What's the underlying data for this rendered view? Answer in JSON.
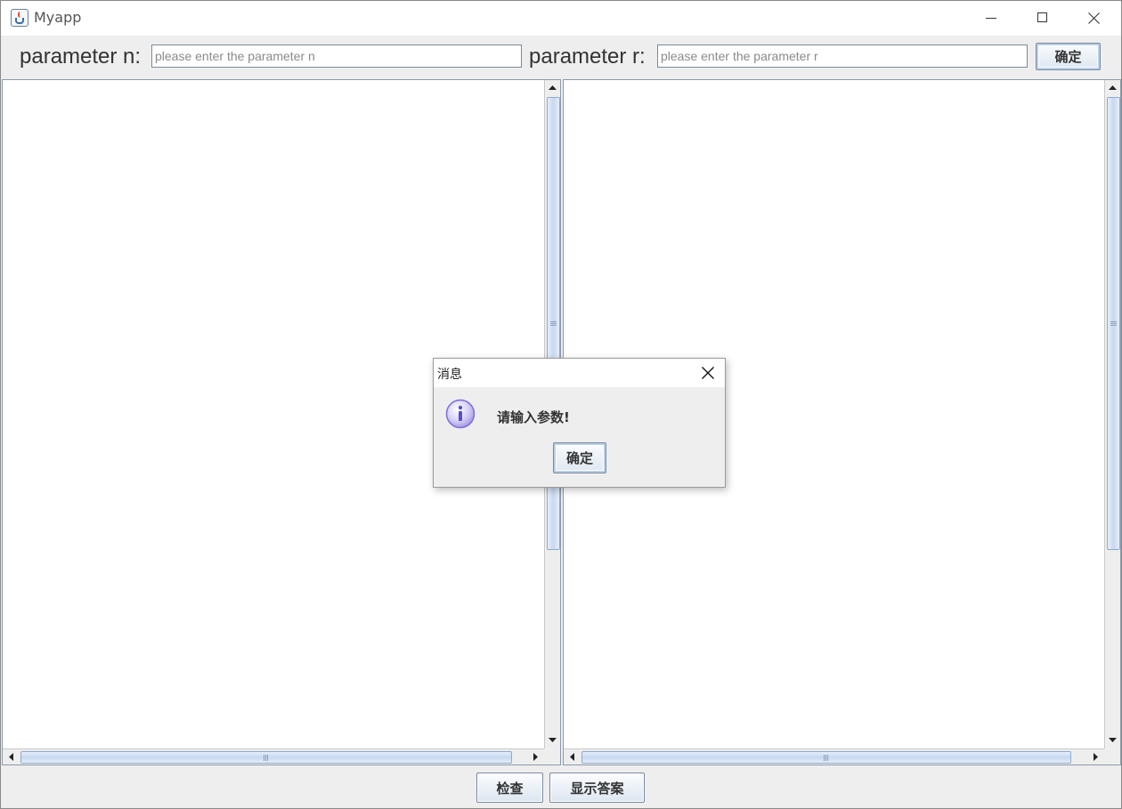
{
  "window": {
    "title": "Myapp",
    "controls": {
      "minimize": "minimize-icon",
      "maximize": "maximize-icon",
      "close": "close-icon"
    }
  },
  "params": {
    "n_label": "parameter n:",
    "n_value": "",
    "n_placeholder": "please enter the parameter n",
    "r_label": "parameter r:",
    "r_value": "",
    "r_placeholder": "please enter the parameter r",
    "confirm_label": "确定"
  },
  "panes": {
    "left_text": "",
    "right_text": ""
  },
  "bottom": {
    "check_label": "检查",
    "show_answer_label": "显示答案"
  },
  "dialog": {
    "title": "消息",
    "message": "请输入参数!",
    "ok_label": "确定",
    "icon": "info-icon"
  },
  "colors": {
    "button_gradient_top": "#fbfcfe",
    "button_gradient_bottom": "#dde6f1",
    "scroll_thumb": "#c6d8ef",
    "info_icon": "#7c6fd6"
  }
}
